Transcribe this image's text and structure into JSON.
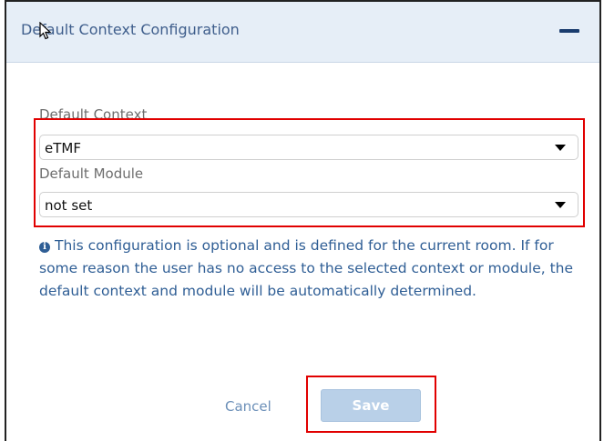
{
  "panel": {
    "title": "Default Context Configuration",
    "collapse_icon": "minus-icon"
  },
  "form": {
    "context_label": "Default Context",
    "context_value": "eTMF",
    "module_label": "Default Module",
    "module_value": "not set"
  },
  "info": {
    "icon": "info-circle-icon",
    "text": "This configuration is optional and is defined for the current room. If for some reason the user has no access to the selected context or module, the default context and module will be automatically determined."
  },
  "actions": {
    "cancel_label": "Cancel",
    "save_label": "Save"
  },
  "colors": {
    "header_bg": "#e6eef7",
    "title": "#3f5e8c",
    "info_text": "#2f5e95",
    "highlight": "#e10000",
    "save_bg": "#b9d0e8"
  }
}
